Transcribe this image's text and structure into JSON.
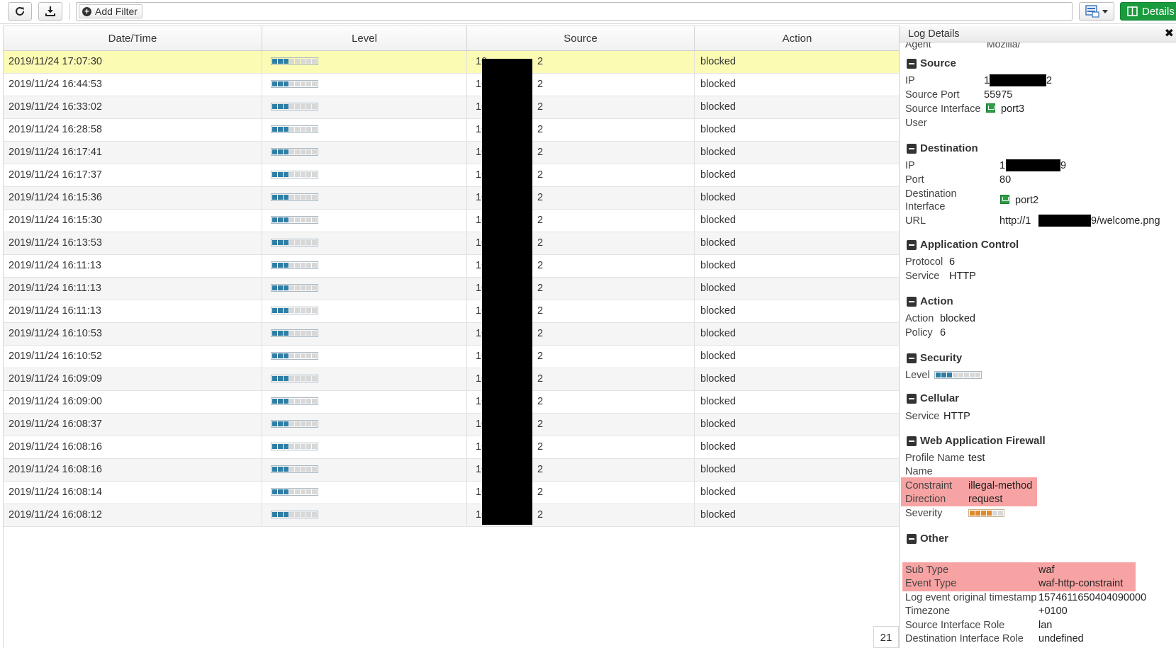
{
  "toolbar": {
    "add_filter_label": "Add Filter",
    "details_label": "Details"
  },
  "grid": {
    "columns": [
      "Date/Time",
      "Level",
      "Source",
      "Action"
    ],
    "rows": [
      {
        "datetime": "2019/11/24 17:07:30",
        "source_prefix": "10",
        "source_suffix": "2",
        "action": "blocked",
        "level": 3
      },
      {
        "datetime": "2019/11/24 16:44:53",
        "source_prefix": "10",
        "source_suffix": "2",
        "action": "blocked",
        "level": 3
      },
      {
        "datetime": "2019/11/24 16:33:02",
        "source_prefix": "10",
        "source_suffix": "2",
        "action": "blocked",
        "level": 3
      },
      {
        "datetime": "2019/11/24 16:28:58",
        "source_prefix": "10",
        "source_suffix": "2",
        "action": "blocked",
        "level": 3
      },
      {
        "datetime": "2019/11/24 16:17:41",
        "source_prefix": "10",
        "source_suffix": "2",
        "action": "blocked",
        "level": 3
      },
      {
        "datetime": "2019/11/24 16:17:37",
        "source_prefix": "10",
        "source_suffix": "2",
        "action": "blocked",
        "level": 3
      },
      {
        "datetime": "2019/11/24 16:15:36",
        "source_prefix": "10",
        "source_suffix": "2",
        "action": "blocked",
        "level": 3
      },
      {
        "datetime": "2019/11/24 16:15:30",
        "source_prefix": "10",
        "source_suffix": "2",
        "action": "blocked",
        "level": 3
      },
      {
        "datetime": "2019/11/24 16:13:53",
        "source_prefix": "10",
        "source_suffix": "2",
        "action": "blocked",
        "level": 3
      },
      {
        "datetime": "2019/11/24 16:11:13",
        "source_prefix": "10",
        "source_suffix": "2",
        "action": "blocked",
        "level": 3
      },
      {
        "datetime": "2019/11/24 16:11:13",
        "source_prefix": "10",
        "source_suffix": "2",
        "action": "blocked",
        "level": 3
      },
      {
        "datetime": "2019/11/24 16:11:13",
        "source_prefix": "10",
        "source_suffix": "2",
        "action": "blocked",
        "level": 3
      },
      {
        "datetime": "2019/11/24 16:10:53",
        "source_prefix": "10",
        "source_suffix": "2",
        "action": "blocked",
        "level": 3
      },
      {
        "datetime": "2019/11/24 16:10:52",
        "source_prefix": "10",
        "source_suffix": "2",
        "action": "blocked",
        "level": 3
      },
      {
        "datetime": "2019/11/24 16:09:09",
        "source_prefix": "10",
        "source_suffix": "2",
        "action": "blocked",
        "level": 3
      },
      {
        "datetime": "2019/11/24 16:09:00",
        "source_prefix": "10",
        "source_suffix": "2",
        "action": "blocked",
        "level": 3
      },
      {
        "datetime": "2019/11/24 16:08:37",
        "source_prefix": "10",
        "source_suffix": "2",
        "action": "blocked",
        "level": 3
      },
      {
        "datetime": "2019/11/24 16:08:16",
        "source_prefix": "10",
        "source_suffix": "2",
        "action": "blocked",
        "level": 3
      },
      {
        "datetime": "2019/11/24 16:08:16",
        "source_prefix": "10",
        "source_suffix": "2",
        "action": "blocked",
        "level": 3
      },
      {
        "datetime": "2019/11/24 16:08:14",
        "source_prefix": "10",
        "source_suffix": "2",
        "action": "blocked",
        "level": 3
      },
      {
        "datetime": "2019/11/24 16:08:12",
        "source_prefix": "10",
        "source_suffix": "2",
        "action": "blocked",
        "level": 3
      }
    ],
    "level_max": 8,
    "page_count": "21"
  },
  "details": {
    "title": "Log Details",
    "cut_off_label": "Agent",
    "cut_off_value": "Mozilla/",
    "source": {
      "title": "Source",
      "ip_label": "IP",
      "ip_prefix": "1",
      "ip_suffix": "2",
      "port_label": "Source Port",
      "port_value": "55975",
      "interface_label": "Source Interface",
      "interface_value": "port3",
      "user_label": "User"
    },
    "destination": {
      "title": "Destination",
      "ip_label": "IP",
      "ip_prefix": "1",
      "ip_suffix": "9",
      "port_label": "Port",
      "port_value": "80",
      "interface_label_1": "Destination",
      "interface_label_2": "Interface",
      "interface_value": "port2",
      "url_label": "URL",
      "url_prefix": "http://1",
      "url_suffix": "9/welcome.png"
    },
    "application_control": {
      "title": "Application Control",
      "protocol_label": "Protocol",
      "protocol_value": "6",
      "service_label": "Service",
      "service_value": "HTTP"
    },
    "action": {
      "title": "Action",
      "action_label": "Action",
      "action_value": "blocked",
      "policy_label": "Policy",
      "policy_value": "6"
    },
    "security": {
      "title": "Security",
      "level_label": "Level",
      "level_value": 3
    },
    "cellular": {
      "title": "Cellular",
      "service_label": "Service",
      "service_value": "HTTP"
    },
    "waf": {
      "title": "Web Application Firewall",
      "profile_label": "Profile Name",
      "profile_value": "test",
      "name_label": "Name",
      "constraint_label": "Constraint",
      "constraint_value": "illegal-method",
      "direction_label": "Direction",
      "direction_value": "request",
      "severity_label": "Severity",
      "severity_value": 4,
      "severity_max": 6
    },
    "other": {
      "title": "Other",
      "subtype_label": "Sub Type",
      "subtype_value": "waf",
      "eventtype_label": "Event Type",
      "eventtype_value": "waf-http-constraint",
      "timestamp_label": "Log event original timestamp",
      "timestamp_value": "1574611650404090000",
      "timezone_label": "Timezone",
      "timezone_value": "+0100",
      "src_role_label": "Source Interface Role",
      "src_role_value": "lan",
      "dst_role_label": "Destination Interface Role",
      "dst_role_value": "undefined"
    }
  },
  "colors": {
    "accent_green": "#1a9b3d",
    "selected_row": "#fbfbb4",
    "level_on": "#2f7ea5",
    "severity_on": "#e08a2c",
    "highlight": "#f8a3a3"
  }
}
